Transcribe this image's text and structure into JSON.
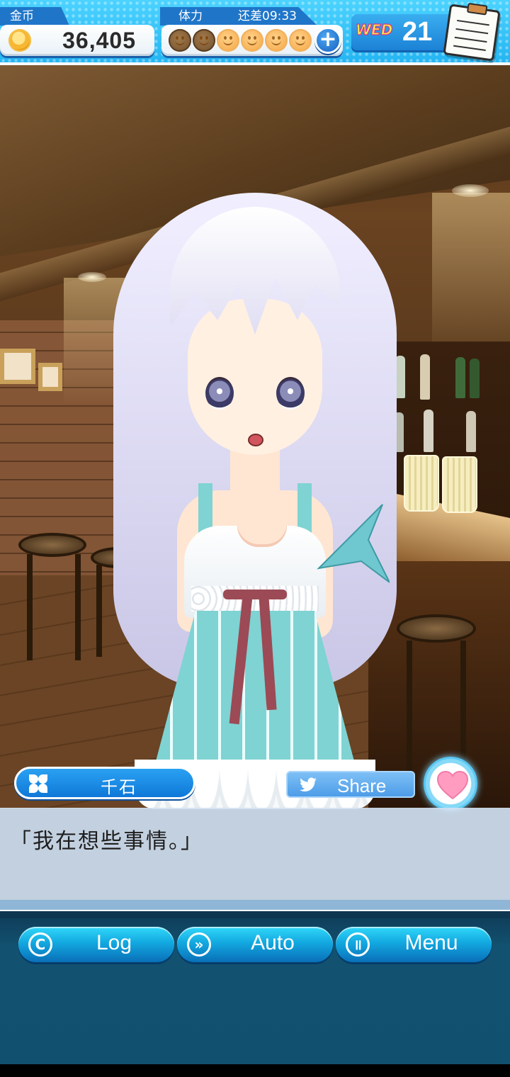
{
  "hud": {
    "coins": {
      "label": "金币",
      "value": "36,405",
      "icon": "coin-icon"
    },
    "stamina": {
      "label": "体力",
      "timer_text": "还差09:33",
      "total": 6,
      "used": 2,
      "plus_icon": "plus-icon"
    },
    "day": {
      "weekday": "WED",
      "number": "21",
      "calendar_icon": "notepad-icon"
    }
  },
  "dialog": {
    "speaker": "千石",
    "speaker_icon": "clover-icon",
    "line": "「我在想些事情。」",
    "share_label": "Share",
    "share_icon": "twitter-bird-icon",
    "favorite_icon": "heart-icon"
  },
  "controls": {
    "log": {
      "label": "Log",
      "glyph": "C"
    },
    "auto": {
      "label": "Auto",
      "glyph": "»"
    },
    "menu": {
      "label": "Menu",
      "glyph": "॥"
    }
  },
  "colors": {
    "hud_blue": "#24b5f2",
    "button_cyan": "#12a8e0",
    "heart_pink": "#ff8fb5",
    "textbox": "#d3e2f2"
  }
}
